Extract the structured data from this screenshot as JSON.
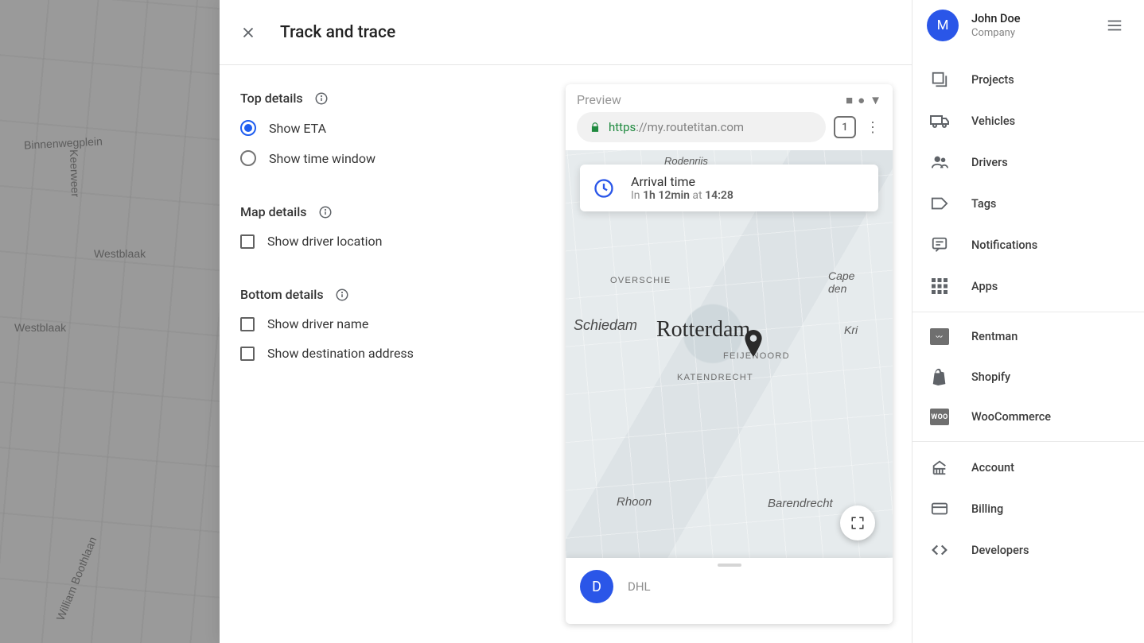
{
  "bg_map_labels": [
    "Binnenwegplein",
    "Keerweer",
    "Westblaak",
    "Westblaak",
    "William Boothlaan"
  ],
  "panel": {
    "title": "Track and trace",
    "sections": {
      "top": {
        "title": "Top details",
        "options": [
          {
            "id": "show-eta",
            "label": "Show ETA",
            "type": "radio",
            "selected": true
          },
          {
            "id": "show-time-window",
            "label": "Show time window",
            "type": "radio",
            "selected": false
          }
        ]
      },
      "map": {
        "title": "Map details",
        "options": [
          {
            "id": "show-driver-location",
            "label": "Show driver location",
            "type": "checkbox",
            "selected": false
          }
        ]
      },
      "bottom": {
        "title": "Bottom details",
        "options": [
          {
            "id": "show-driver-name",
            "label": "Show driver name",
            "type": "checkbox",
            "selected": false
          },
          {
            "id": "show-destination-addr",
            "label": "Show destination address",
            "type": "checkbox",
            "selected": false
          }
        ]
      }
    }
  },
  "preview": {
    "label": "Preview",
    "url_scheme": "https",
    "url_sep": "://",
    "url_host": "my.routetitan.com",
    "tab_count": "1",
    "eta": {
      "title": "Arrival time",
      "prefix": "In",
      "duration": "1h 12min",
      "middle": "at",
      "time": "14:28"
    },
    "city_label": "Rotterdam",
    "area_labels": [
      "Rodenrijs",
      "OVERSCHIE",
      "Capelle aan den IJssel",
      "Schiedam",
      "FEIJENOORD",
      "KATENDRECHT",
      "Krimpen",
      "Rhoon",
      "Barendrecht"
    ],
    "carrier": {
      "initial": "D",
      "name": "DHL"
    }
  },
  "sidebar": {
    "user_initial": "M",
    "user_name": "John Doe",
    "user_sub": "Company",
    "groups": [
      {
        "items": [
          {
            "id": "projects",
            "label": "Projects",
            "icon": "projects-icon"
          },
          {
            "id": "vehicles",
            "label": "Vehicles",
            "icon": "vehicles-icon"
          },
          {
            "id": "drivers",
            "label": "Drivers",
            "icon": "drivers-icon"
          },
          {
            "id": "tags",
            "label": "Tags",
            "icon": "tags-icon"
          },
          {
            "id": "notifications",
            "label": "Notifications",
            "icon": "notifications-icon"
          },
          {
            "id": "apps",
            "label": "Apps",
            "icon": "apps-icon"
          }
        ]
      },
      {
        "items": [
          {
            "id": "rentman",
            "label": "Rentman",
            "icon": "rentman-icon"
          },
          {
            "id": "shopify",
            "label": "Shopify",
            "icon": "shopify-icon"
          },
          {
            "id": "woocommerce",
            "label": "WooCommerce",
            "icon": "woocommerce-icon"
          }
        ]
      },
      {
        "items": [
          {
            "id": "account",
            "label": "Account",
            "icon": "account-icon"
          },
          {
            "id": "billing",
            "label": "Billing",
            "icon": "billing-icon"
          },
          {
            "id": "developers",
            "label": "Developers",
            "icon": "developers-icon"
          }
        ]
      }
    ]
  }
}
